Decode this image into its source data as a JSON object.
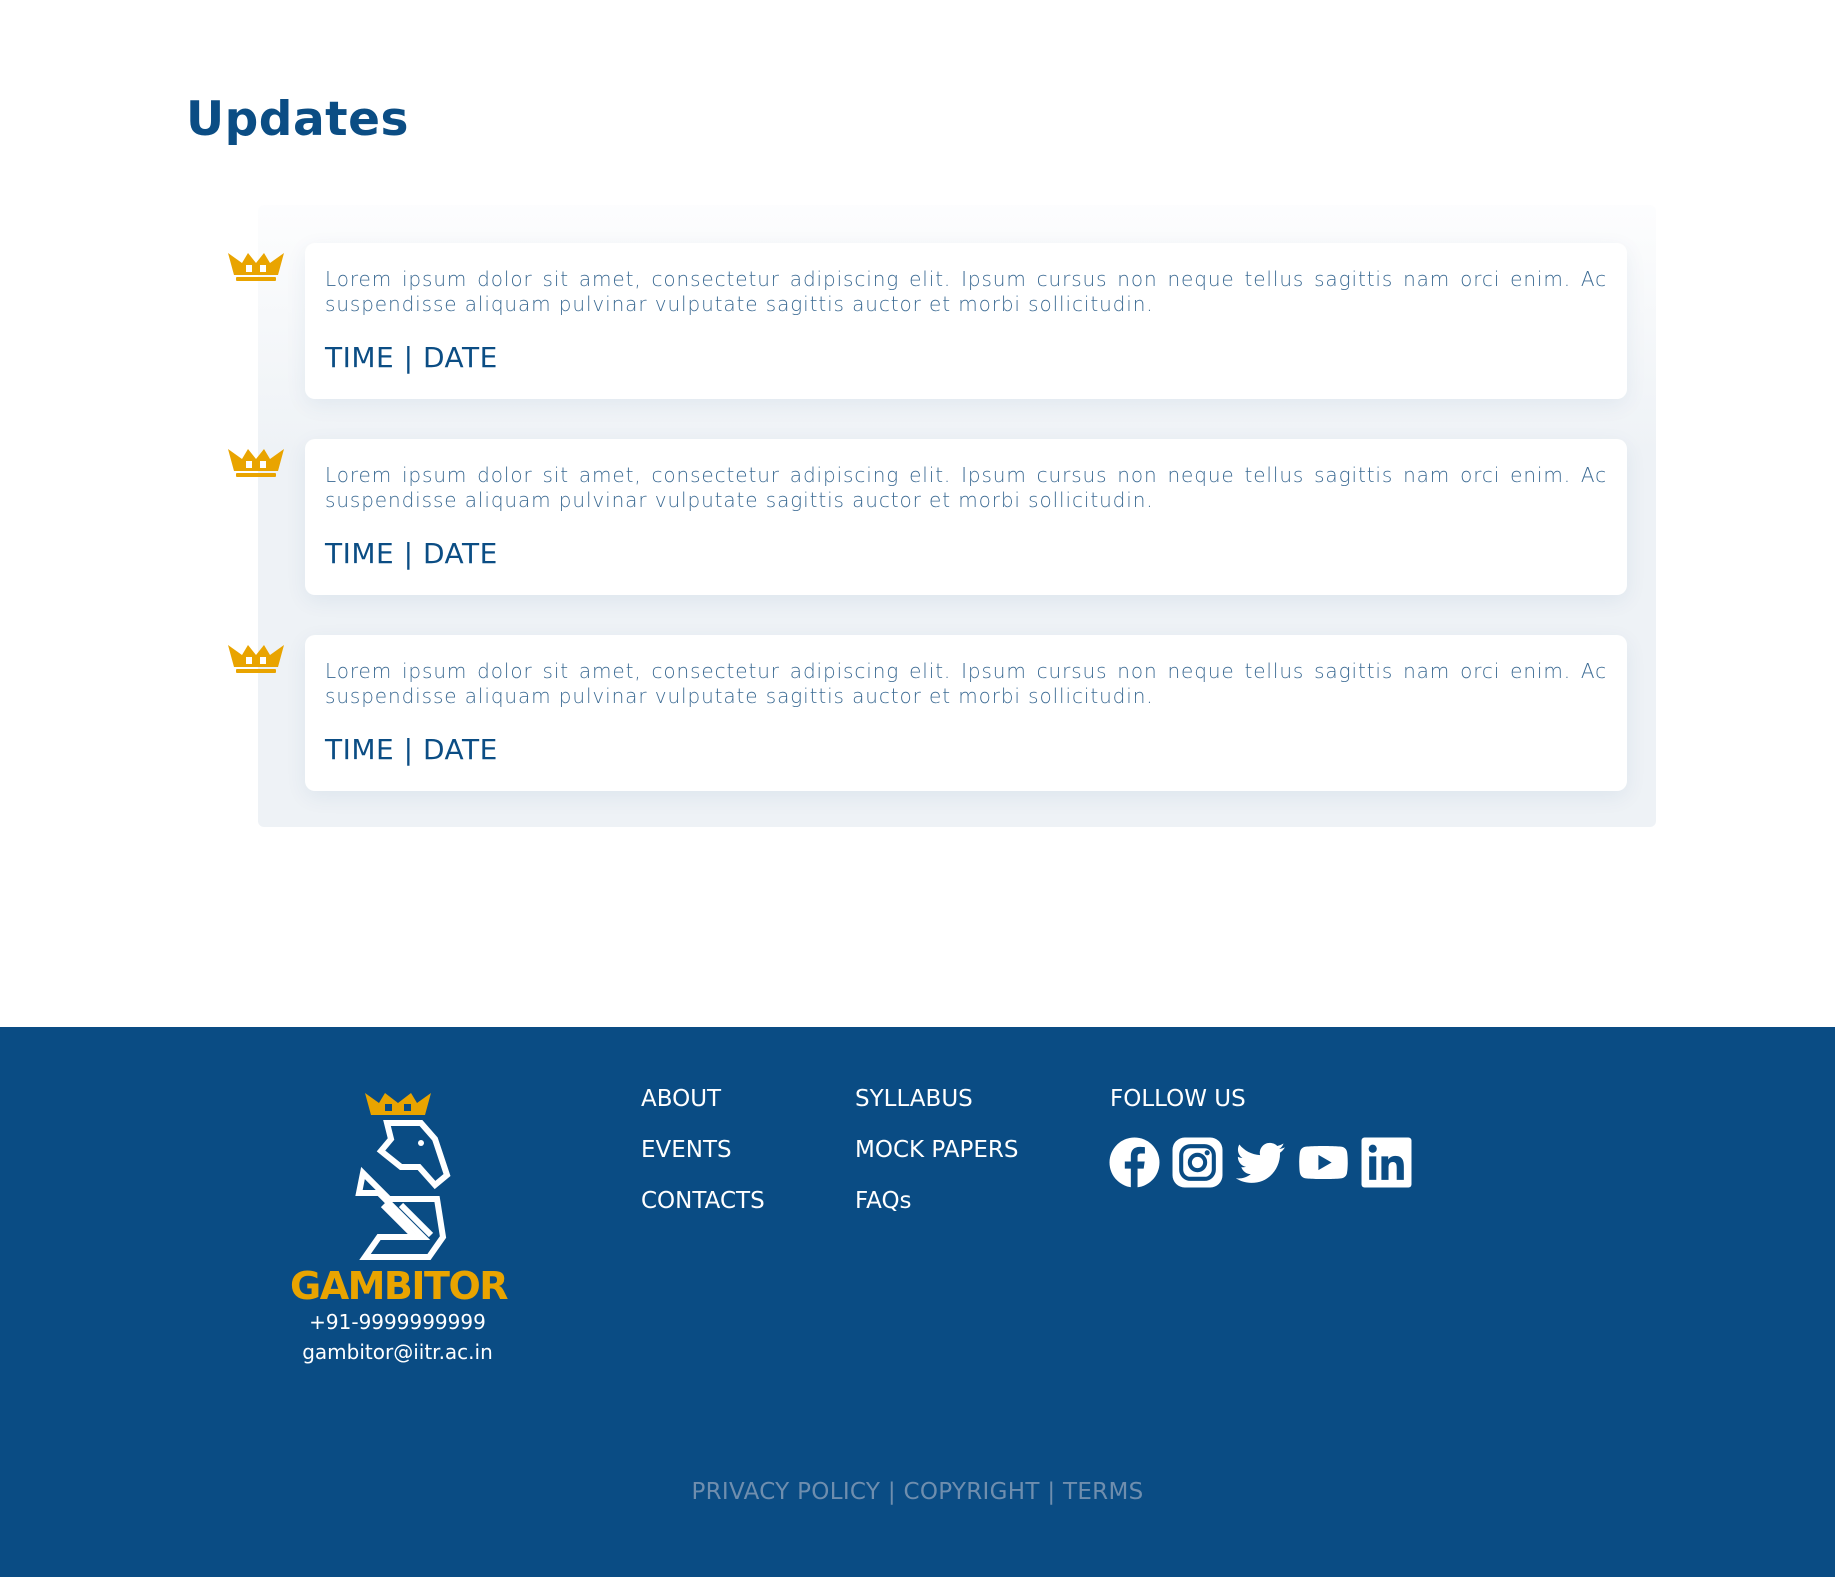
{
  "updates": {
    "title": "Updates",
    "items": [
      {
        "text": "Lorem ipsum dolor sit amet, consectetur adipiscing elit. Ipsum cursus non neque tellus sagittis nam orci enim. Ac suspendisse aliquam pulvinar vulputate sagittis auctor et morbi sollicitudin.",
        "meta": "TIME | DATE",
        "icon": "crown-icon"
      },
      {
        "text": "Lorem ipsum dolor sit amet, consectetur adipiscing elit. Ipsum cursus non neque tellus sagittis nam orci enim. Ac suspendisse aliquam pulvinar vulputate sagittis auctor et morbi sollicitudin.",
        "meta": "TIME | DATE",
        "icon": "crown-icon"
      },
      {
        "text": "Lorem ipsum dolor sit amet, consectetur adipiscing elit. Ipsum cursus non neque tellus sagittis nam orci enim. Ac suspendisse aliquam pulvinar vulputate sagittis auctor et morbi sollicitudin.",
        "meta": "TIME | DATE",
        "icon": "crown-icon"
      }
    ]
  },
  "footer": {
    "brand": "GAMBITOR",
    "phone": "+91-9999999999",
    "email": "gambitor@iitr.ac.in",
    "links_col1": [
      "ABOUT",
      "EVENTS",
      "CONTACTS"
    ],
    "links_col2": [
      "SYLLABUS",
      "MOCK PAPERS",
      "FAQs"
    ],
    "follow_title": "FOLLOW US",
    "socials": [
      "facebook-icon",
      "instagram-icon",
      "twitter-icon",
      "youtube-icon",
      "linkedin-icon"
    ],
    "legal": {
      "privacy": "PRIVACY POLICY",
      "separator": " | ",
      "copyright": "COPYRIGHT",
      "terms": "TERMS"
    }
  },
  "colors": {
    "primary": "#0b4d84",
    "footer_bg": "#0a4c84",
    "accent": "#e9a400",
    "text_muted": "#3b6a93",
    "legal_text": "#6f8eae",
    "panel_bg": "#eef2f6"
  }
}
